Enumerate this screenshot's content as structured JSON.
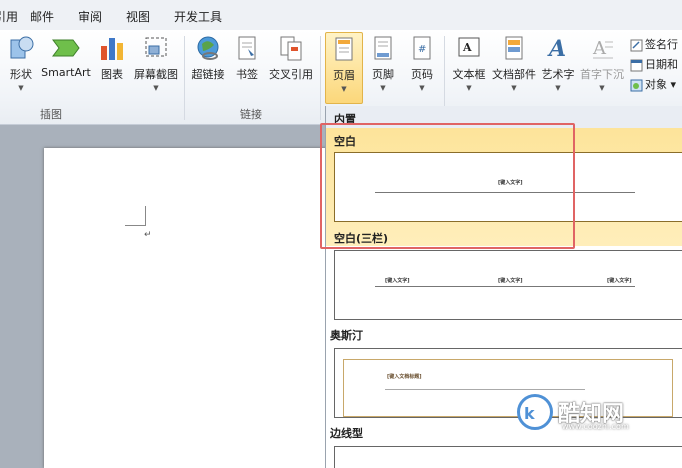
{
  "tabs": [
    "引用",
    "邮件",
    "审阅",
    "视图",
    "开发工具"
  ],
  "ribbon": {
    "illustrations": {
      "shapes": "形状",
      "smartart": "SmartArt",
      "chart": "图表",
      "screenshot": "屏幕截图",
      "group_label": "插图"
    },
    "links": {
      "hyperlink": "超链接",
      "bookmark": "书签",
      "cross_reference": "交叉引用",
      "group_label": "链接"
    },
    "header_footer": {
      "header": "页眉",
      "footer": "页脚",
      "page_number": "页码"
    },
    "text": {
      "textbox": "文本框",
      "quick_parts": "文档部件",
      "wordart": "艺术字",
      "dropcap": "首字下沉",
      "signature_line": "签名行",
      "date_time": "日期和",
      "object": "对象"
    }
  },
  "gallery": {
    "section_builtin": "内置",
    "items": [
      {
        "name": "空白",
        "placeholders": [
          "[键入文字]"
        ]
      },
      {
        "name": "空白(三栏)",
        "placeholders": [
          "[键入文字]",
          "[键入文字]",
          "[键入文字]"
        ]
      },
      {
        "name": "奥斯汀",
        "placeholders": [
          "[键入文档标题]"
        ]
      },
      {
        "name": "边线型",
        "placeholders": []
      }
    ]
  },
  "document": {
    "paragraph_mark": "↵"
  },
  "watermark": {
    "name": "酷知网",
    "url": "www.coozhi.com"
  },
  "colors": {
    "highlight_box": "#e06464",
    "selected_item": "#fde49a",
    "accent_blue": "#4f91d6"
  }
}
